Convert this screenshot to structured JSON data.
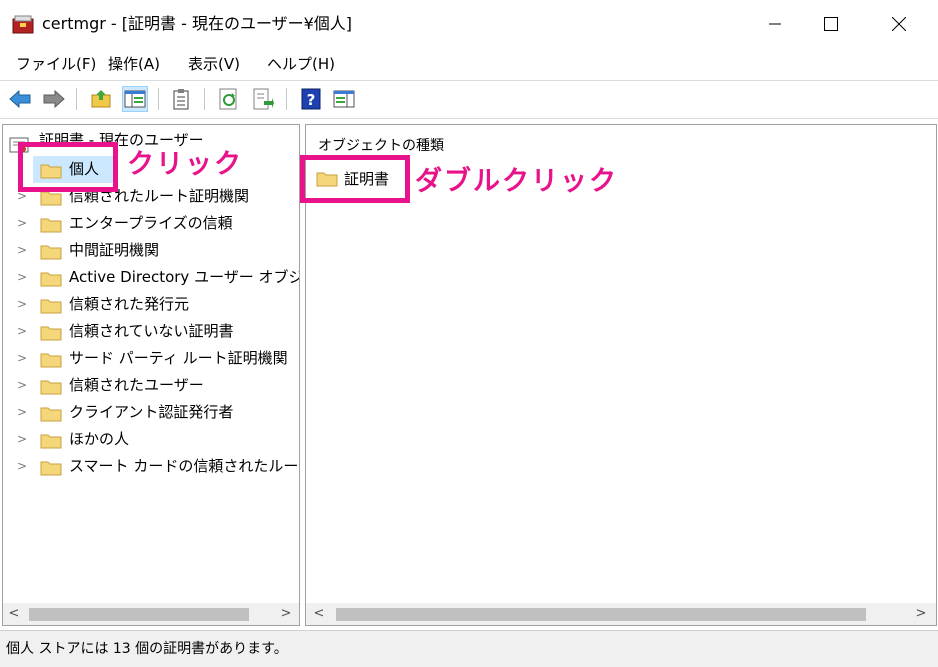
{
  "window": {
    "title": "certmgr - [証明書 - 現在のユーザー¥個人]"
  },
  "menu": [
    "ファイル(F)",
    "操作(A)",
    "表示(V)",
    "ヘルプ(H)"
  ],
  "toolbar": {
    "icons": [
      "back-arrow-icon",
      "forward-arrow-icon",
      "up-folder-icon",
      "show-hide-tree-icon",
      "clipboard-icon",
      "refresh-icon",
      "export-list-icon",
      "help-icon",
      "console-view-icon"
    ]
  },
  "tree": {
    "root": "証明書 - 現在のユーザー",
    "items": [
      "個人",
      "信頼されたルート証明機関",
      "エンタープライズの信頼",
      "中間証明機関",
      "Active Directory ユーザー オブジェクト",
      "信頼された発行元",
      "信頼されていない証明書",
      "サード パーティ ルート証明機関",
      "信頼されたユーザー",
      "クライアント認証発行者",
      "ほかの人",
      "スマート カードの信頼されたルート"
    ]
  },
  "content": {
    "column_header": "オブジェクトの種類",
    "items": [
      "証明書"
    ]
  },
  "status": "個人 ストアには 13 個の証明書があります。",
  "annotations": {
    "click": "クリック",
    "double_click": "ダブルクリック"
  },
  "colors": {
    "highlight": "#e8128b",
    "folder": "#f5d67a",
    "selection": "#cce8ff"
  }
}
